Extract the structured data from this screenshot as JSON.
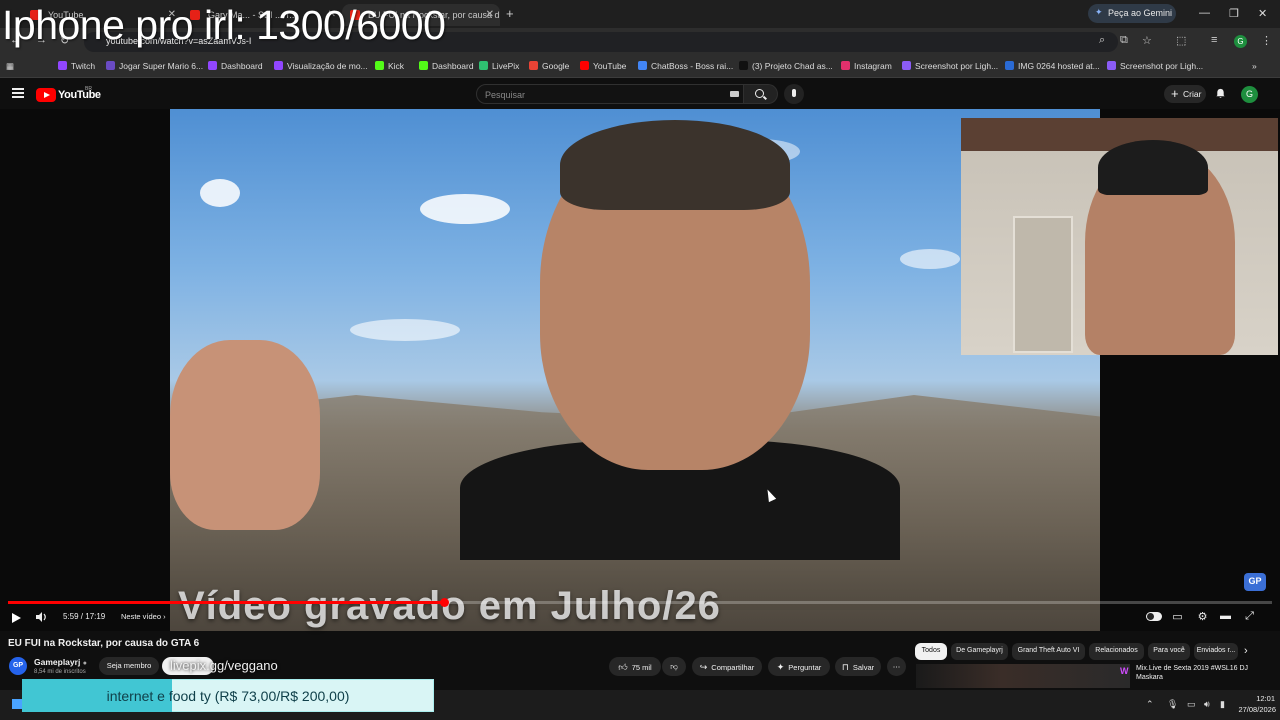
{
  "overlay_title": "Iphone pro irl: 1300/6000",
  "browser": {
    "tabs": [
      {
        "label": "YouTube",
        "active": false
      },
      {
        "label": "Gary Ma... - Still ... T...",
        "active": false
      },
      {
        "label": "EU FUI na Rockstar, por causa d...",
        "active": true
      }
    ],
    "new_tab": "+",
    "gemini_button": "Peça ao Gemini",
    "url": "youtube.com/watch?v=asZaamVJs-I",
    "window_controls": [
      "—",
      "❐",
      "✕"
    ]
  },
  "bookmarks": [
    {
      "label": "Twitch",
      "color": "#9146ff"
    },
    {
      "label": "Jogar Super Mario 6...",
      "color": "#6a4bc4"
    },
    {
      "label": "Dashboard",
      "color": "#9146ff"
    },
    {
      "label": "Visualização de mo...",
      "color": "#9146ff"
    },
    {
      "label": "Kick",
      "color": "#53fc18"
    },
    {
      "label": "Dashboard",
      "color": "#53fc18"
    },
    {
      "label": "LivePix",
      "color": "#2fbf71"
    },
    {
      "label": "Google",
      "color": "#ea4335"
    },
    {
      "label": "YouTube",
      "color": "#ff0000"
    },
    {
      "label": "ChatBoss - Boss rai...",
      "color": "#4285f4"
    },
    {
      "label": "(3) Projeto Chad as...",
      "color": "#111111"
    },
    {
      "label": "Instagram",
      "color": "#e1306c"
    },
    {
      "label": "Screenshot por Ligh...",
      "color": "#8b5cf6"
    },
    {
      "label": "IMG 0264 hosted at...",
      "color": "#2a6ad4"
    },
    {
      "label": "Screenshot por Ligh...",
      "color": "#8b5cf6"
    }
  ],
  "youtube": {
    "logo_text": "YouTube",
    "region": "BR",
    "search_placeholder": "Pesquisar",
    "create_button": "Criar",
    "avatar_letter": "G"
  },
  "player": {
    "caption_overlay": "Vídeo gravado em Julho/26",
    "time": "5:59 / 17:19",
    "chapter": "Neste vídeo",
    "progress_fraction": 0.345
  },
  "video": {
    "title": "EU FUI na Rockstar, por causa do GTA 6",
    "channel": "Gameplayrj",
    "subscribers": "8,54 mi de inscritos",
    "join_button": "Seja membro",
    "overlay_link": "livepix.gg/veggano",
    "likes": "75 mil",
    "share": "Compartilhar",
    "ask": "Perguntar",
    "save": "Salvar",
    "channel_badge": "GP"
  },
  "chips": [
    "Todos",
    "De Gameplayrj",
    "Grand Theft Auto VI",
    "Relacionados",
    "Para você",
    "Enviados r..."
  ],
  "recommendation": {
    "title_line1": "Mix.Live de Sexta 2019 #WSL16 DJ",
    "title_line2": "Maskara"
  },
  "donation": {
    "text": "internet e food ty (R$ 73,00/R$ 200,00)",
    "raised": 73,
    "goal": 200,
    "color": "#41c6d3"
  },
  "taskbar": {
    "time": "12:01",
    "date": "27/08/2026"
  }
}
